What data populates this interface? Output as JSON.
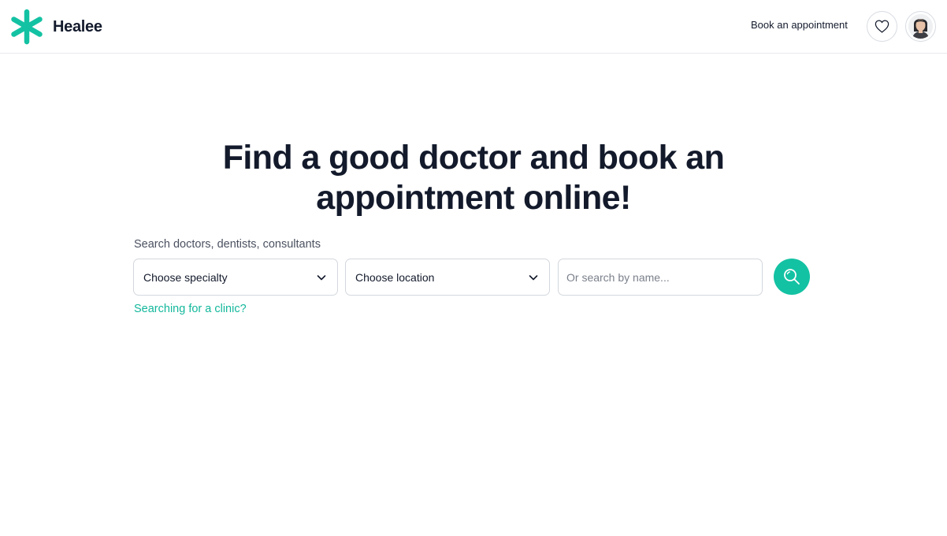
{
  "brand": {
    "name": "Healee",
    "color": "#13c2a3",
    "icon": "asterisk-logo-icon"
  },
  "header": {
    "book_link": "Book an appointment",
    "favorites_icon": "heart-icon",
    "avatar_icon": "user-avatar"
  },
  "hero": {
    "title_line1": "Find a good doctor and book an",
    "title_line2": "appointment online!"
  },
  "search": {
    "label": "Search doctors, dentists, consultants",
    "specialty": {
      "value": "Choose specialty",
      "icon": "chevron-down-icon"
    },
    "location": {
      "value": "Choose location",
      "icon": "chevron-down-icon"
    },
    "name_placeholder": "Or search by name...",
    "button_icon": "search-icon",
    "clinic_link": "Searching for a clinic?"
  }
}
